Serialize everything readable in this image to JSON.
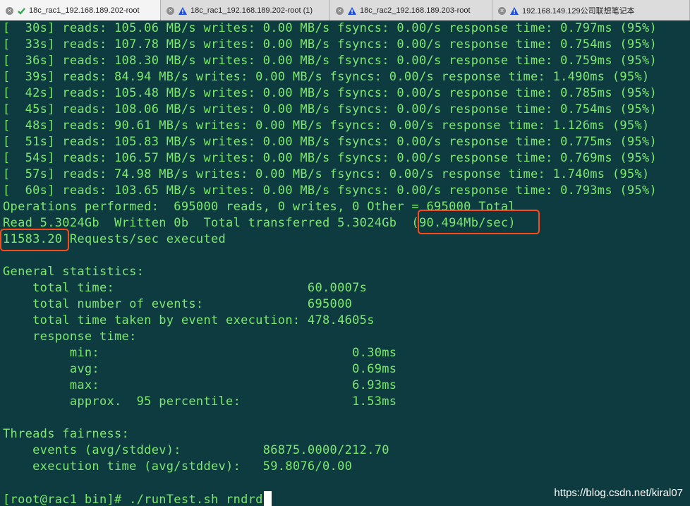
{
  "tabs": [
    {
      "label": "18c_rac1_192.168.189.202-root",
      "status": "check-icon",
      "active": true
    },
    {
      "label": "18c_rac1_192.168.189.202-root (1)",
      "status": "warning-icon",
      "active": false
    },
    {
      "label": "18c_rac2_192.168.189.203-root",
      "status": "warning-icon",
      "active": false
    },
    {
      "label": "192.168.149.129公司联想笔记本",
      "status": "warning-icon",
      "active": false
    }
  ],
  "terminal": {
    "lines": [
      "[  30s] reads: 105.06 MB/s writes: 0.00 MB/s fsyncs: 0.00/s response time: 0.797ms (95%)",
      "[  33s] reads: 107.78 MB/s writes: 0.00 MB/s fsyncs: 0.00/s response time: 0.754ms (95%)",
      "[  36s] reads: 108.30 MB/s writes: 0.00 MB/s fsyncs: 0.00/s response time: 0.759ms (95%)",
      "[  39s] reads: 84.94 MB/s writes: 0.00 MB/s fsyncs: 0.00/s response time: 1.490ms (95%)",
      "[  42s] reads: 105.48 MB/s writes: 0.00 MB/s fsyncs: 0.00/s response time: 0.785ms (95%)",
      "[  45s] reads: 108.06 MB/s writes: 0.00 MB/s fsyncs: 0.00/s response time: 0.754ms (95%)",
      "[  48s] reads: 90.61 MB/s writes: 0.00 MB/s fsyncs: 0.00/s response time: 1.126ms (95%)",
      "[  51s] reads: 105.83 MB/s writes: 0.00 MB/s fsyncs: 0.00/s response time: 0.775ms (95%)",
      "[  54s] reads: 106.57 MB/s writes: 0.00 MB/s fsyncs: 0.00/s response time: 0.769ms (95%)",
      "[  57s] reads: 74.98 MB/s writes: 0.00 MB/s fsyncs: 0.00/s response time: 1.740ms (95%)",
      "[  60s] reads: 103.65 MB/s writes: 0.00 MB/s fsyncs: 0.00/s response time: 0.793ms (95%)",
      "Operations performed:  695000 reads, 0 writes, 0 Other = 695000 Total",
      "Read 5.3024Gb  Written 0b  Total transferred 5.3024Gb  (90.494Mb/sec)",
      "11583.20 Requests/sec executed",
      "",
      "General statistics:",
      "    total time:                          60.0007s",
      "    total number of events:              695000",
      "    total time taken by event execution: 478.4605s",
      "    response time:",
      "         min:                                  0.30ms",
      "         avg:                                  0.69ms",
      "         max:                                  6.93ms",
      "         approx.  95 percentile:               1.53ms",
      "",
      "Threads fairness:",
      "    events (avg/stddev):           86875.0000/212.70",
      "    execution time (avg/stddev):   59.8076/0.00",
      ""
    ],
    "prompt": "[root@rac1 bin]# ./runTest.sh rndrd"
  },
  "highlights": [
    {
      "label": "throughput-highlight",
      "text": "(90.494Mb/sec)"
    },
    {
      "label": "requests-highlight",
      "text": "11583.20"
    }
  ],
  "watermark": "https://blog.csdn.net/kiral07",
  "colors": {
    "terminal_bg": "#0d3b40",
    "terminal_fg": "#7ee86e",
    "highlight_border": "#ff4a17",
    "tab_active_check": "#2fa84f",
    "tab_warning": "#1e4fd8"
  }
}
